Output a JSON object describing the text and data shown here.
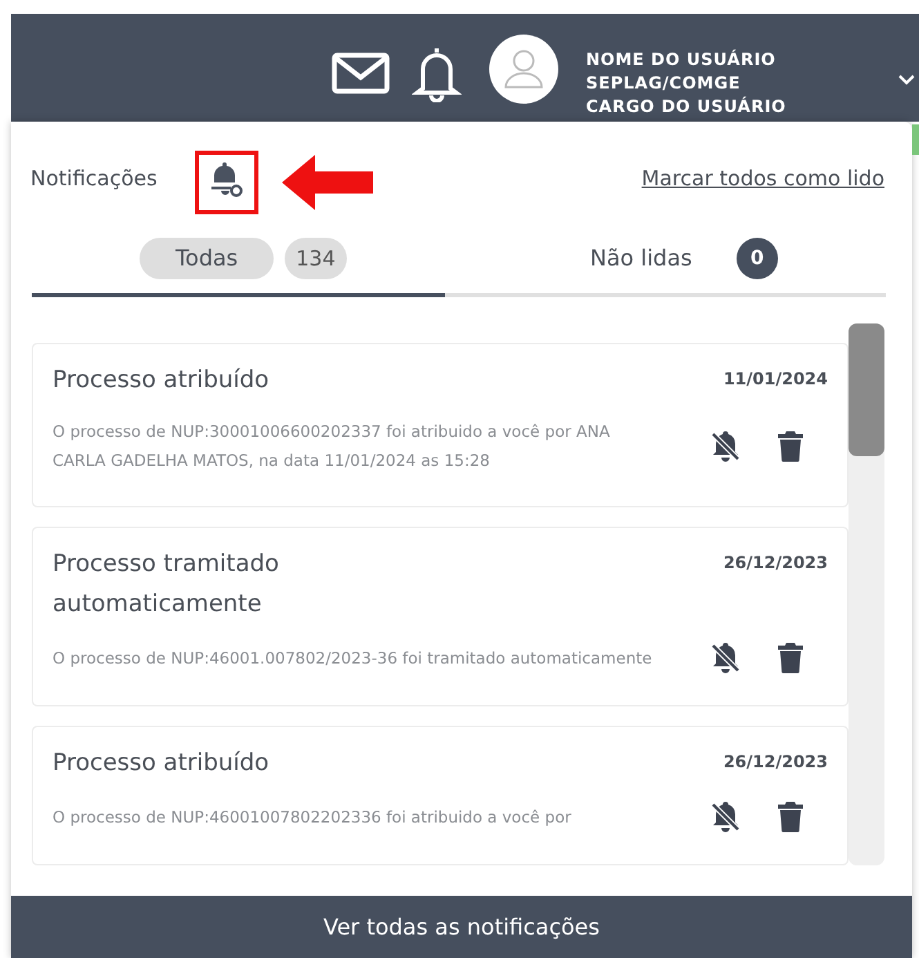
{
  "header": {
    "user_lines": [
      "NOME DO USUÁRIO",
      "SEPLAG/COMGE",
      "CARGO DO USUÁRIO"
    ]
  },
  "panel": {
    "title": "Notificações",
    "mark_all": "Marcar todos como lido"
  },
  "tabs": [
    {
      "label": "Todas",
      "count": "134",
      "selected": true
    },
    {
      "label": "Não lidas",
      "count": "0",
      "selected": false
    }
  ],
  "notifications": [
    {
      "title": "Processo atribuído",
      "date": "11/01/2024",
      "body": "O processo de NUP:30001006600202337 foi atribuido a você por ANA CARLA GADELHA MATOS, na data 11/01/2024 as 15:28"
    },
    {
      "title": "Processo tramitado automaticamente",
      "date": "26/12/2023",
      "body": "O processo de NUP:46001.007802/2023-36 foi tramitado automaticamente"
    },
    {
      "title": "Processo atribuído",
      "date": "26/12/2023",
      "body": "O processo de NUP:46001007802202336 foi atribuido a você por"
    }
  ],
  "footer_button": "Ver todas as notificações"
}
